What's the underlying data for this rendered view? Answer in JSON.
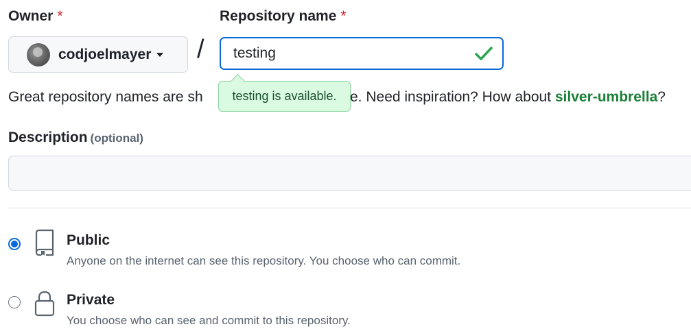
{
  "owner": {
    "label": "Owner",
    "required_mark": "*",
    "selected": "codjoelmayer"
  },
  "separator": "/",
  "repository": {
    "label": "Repository name",
    "required_mark": "*",
    "value": "testing",
    "status_icon": "check-icon",
    "tooltip": "testing is available."
  },
  "helper": {
    "text_start": "Great repository names are sh",
    "text_end": "e. Need inspiration? How about ",
    "suggestion": "silver-umbrella",
    "question_mark": "?"
  },
  "description": {
    "label": "Description",
    "optional": "(optional)",
    "value": ""
  },
  "visibility": {
    "options": [
      {
        "title": "Public",
        "description": "Anyone on the internet can see this repository. You choose who can commit.",
        "icon": "repo-icon",
        "checked": true
      },
      {
        "title": "Private",
        "description": "You choose who can see and commit to this repository.",
        "icon": "lock-icon",
        "checked": false
      }
    ]
  },
  "colors": {
    "accent": "#0969da",
    "success": "#1a7f37",
    "danger": "#cf222e",
    "tooltip_bg": "#dafbe1"
  }
}
